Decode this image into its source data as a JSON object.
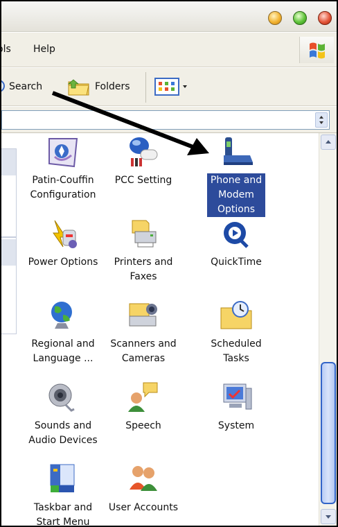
{
  "menu": {
    "tools_partial": "ols",
    "help": "Help"
  },
  "toolbar": {
    "search": "Search",
    "folders": "Folders"
  },
  "items": [
    {
      "label": "Patin-Couffin Configuration",
      "icon": "patin-couffin-icon"
    },
    {
      "label": "PCC Setting",
      "icon": "pcc-setting-icon"
    },
    {
      "label": "Phone and Modem Options",
      "icon": "phone-modem-icon",
      "selected": true
    },
    {
      "label": "Power Options",
      "icon": "power-options-icon"
    },
    {
      "label": "Printers and Faxes",
      "icon": "printer-icon"
    },
    {
      "label": "QuickTime",
      "icon": "quicktime-icon"
    },
    {
      "label": "Regional and Language ...",
      "icon": "globe-icon"
    },
    {
      "label": "Scanners and Cameras",
      "icon": "scanner-icon"
    },
    {
      "label": "Scheduled Tasks",
      "icon": "scheduled-tasks-icon"
    },
    {
      "label": "Sounds and Audio Devices",
      "icon": "speaker-icon"
    },
    {
      "label": "Speech",
      "icon": "speech-icon"
    },
    {
      "label": "System",
      "icon": "system-icon"
    },
    {
      "label": "Taskbar and Start Menu",
      "icon": "taskbar-icon"
    },
    {
      "label": "User Accounts",
      "icon": "user-accounts-icon"
    }
  ],
  "colors": {
    "selection": "#2d4b9b",
    "scroll_thumb_border": "#3264c8"
  }
}
